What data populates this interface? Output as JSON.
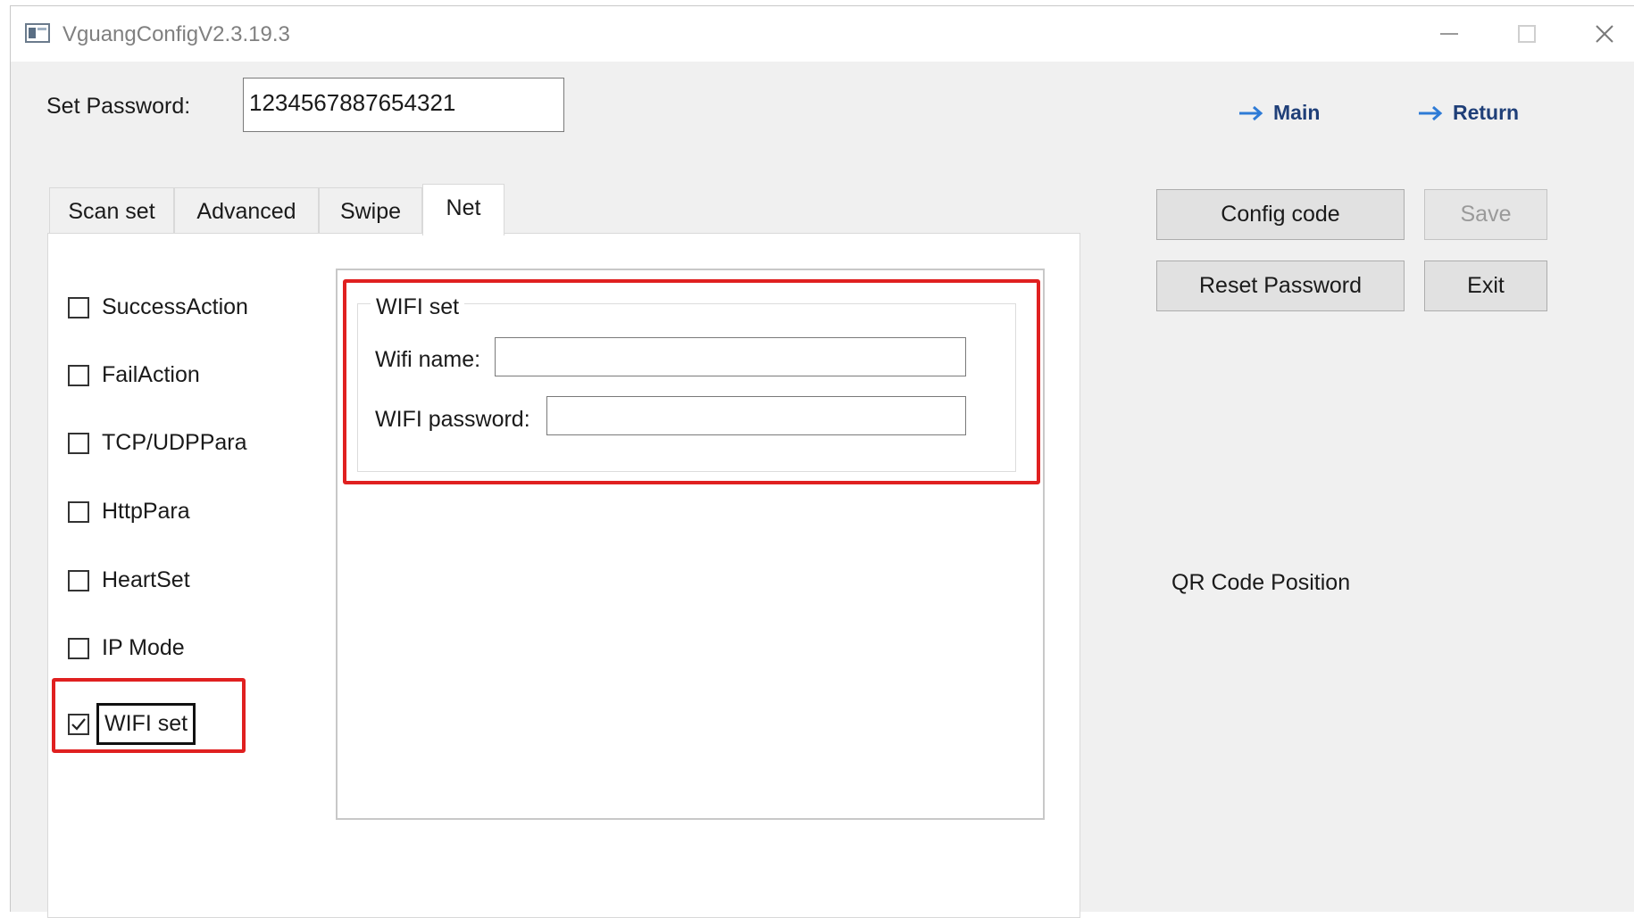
{
  "window": {
    "title": "VguangConfigV2.3.19.3",
    "controls": {
      "minimize": "minimize-icon",
      "maximize": "maximize-icon",
      "close": "close-icon"
    }
  },
  "password": {
    "label": "Set Password:",
    "value": "1234567887654321"
  },
  "nav": {
    "main_label": "Main",
    "return_label": "Return",
    "accent": "#1f3f78",
    "arrow": "#2e7bd6"
  },
  "tabs": [
    {
      "label": "Scan set",
      "active": false
    },
    {
      "label": "Advanced",
      "active": false
    },
    {
      "label": "Swipe",
      "active": false
    },
    {
      "label": "Net",
      "active": true
    }
  ],
  "options": [
    {
      "label": "SuccessAction",
      "checked": false
    },
    {
      "label": "FailAction",
      "checked": false
    },
    {
      "label": "TCP/UDPPara",
      "checked": false
    },
    {
      "label": "HttpPara",
      "checked": false
    },
    {
      "label": "HeartSet",
      "checked": false
    },
    {
      "label": "IP Mode",
      "checked": false
    },
    {
      "label": "WIFI set",
      "checked": true
    }
  ],
  "wifi": {
    "legend": "WIFI set",
    "name_label": "Wifi name:",
    "name_value": "",
    "password_label": "WIFI password:",
    "password_value": ""
  },
  "buttons": {
    "config_code": "Config code",
    "save": "Save",
    "reset_password": "Reset Password",
    "exit": "Exit"
  },
  "qr_label": "QR Code Position",
  "highlight_color": "#e02020"
}
